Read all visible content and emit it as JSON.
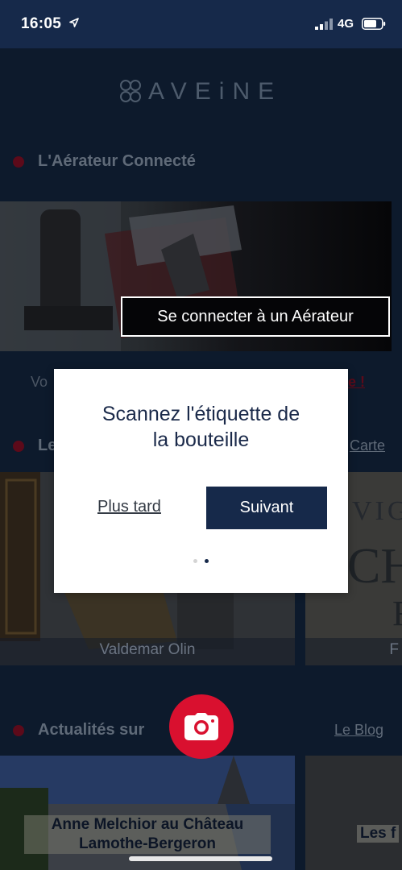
{
  "status_bar": {
    "time": "16:05",
    "network": "4G",
    "icons": [
      "location-arrow-icon",
      "signal-icon",
      "battery-icon"
    ]
  },
  "brand": {
    "logo_text": "AVEiNE",
    "logo_icon": "grape-cluster-icon"
  },
  "aerator_section": {
    "title": "L'Aérateur Connecté",
    "connect_button": "Se connecter à un Aérateur",
    "partial_left": "Vo",
    "partial_right": "e !"
  },
  "wines_section": {
    "title_partial": "Le",
    "link": "Carte",
    "cards": [
      {
        "caption": "Valdemar Olin"
      },
      {
        "caption": "F"
      }
    ],
    "right_card_partial_text": [
      "VIG",
      "CH",
      "F"
    ]
  },
  "news_section": {
    "title": "Actualités sur",
    "link": "Le Blog",
    "cards": [
      {
        "caption_line1": "Anne Melchior au Château",
        "caption_line2": "Lamothe-Bergeron"
      },
      {
        "caption_line1": "Les f"
      }
    ]
  },
  "modal": {
    "title_line1": "Scannez l'étiquette de",
    "title_line2": "la bouteille",
    "later_label": "Plus tard",
    "next_label": "Suivant",
    "pager": {
      "total": 2,
      "active": 2
    }
  },
  "fab": {
    "icon": "camera-icon"
  },
  "colors": {
    "navy": "#16294a",
    "accent_red": "#d9102f",
    "background": "#0d1a2c"
  }
}
